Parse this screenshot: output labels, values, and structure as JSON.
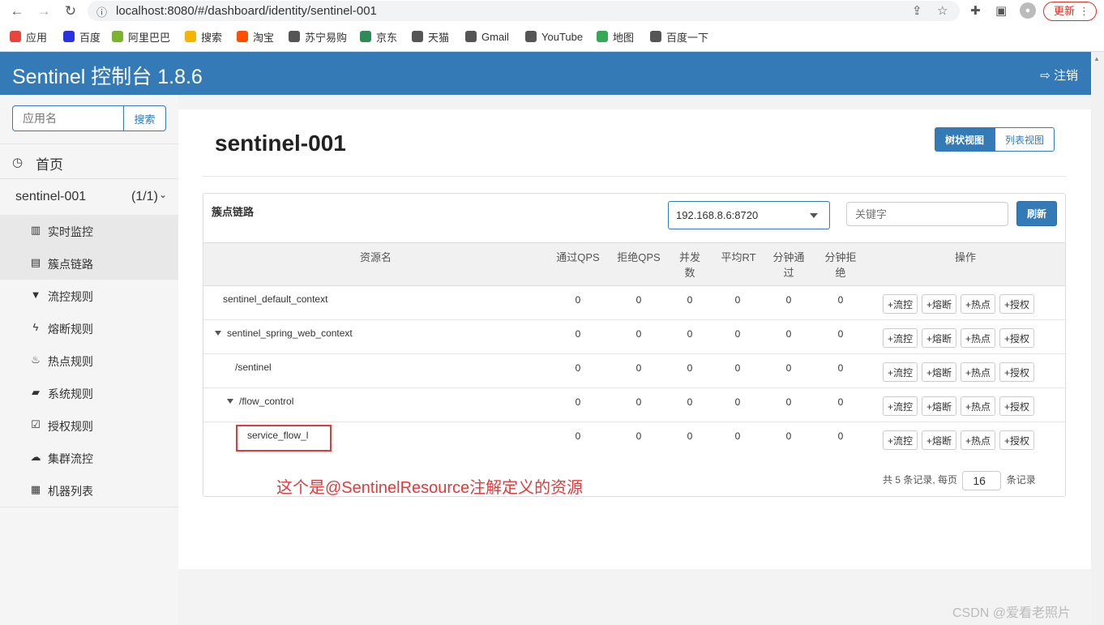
{
  "browser": {
    "url": "localhost:8080/#/dashboard/identity/sentinel-001",
    "update_label": "更新",
    "bookmarks": [
      {
        "label": "应用",
        "icon": "apps-icon",
        "color": "#e8453c"
      },
      {
        "label": "百度",
        "icon": "baidu-icon",
        "color": "#2932e1"
      },
      {
        "label": "阿里巴巴",
        "icon": "alibaba-icon",
        "color": "#7bb32e"
      },
      {
        "label": "搜索",
        "icon": "search-engine-icon",
        "color": "#f4b400"
      },
      {
        "label": "淘宝",
        "icon": "taobao-icon",
        "color": "#ff5000"
      },
      {
        "label": "苏宁易购",
        "icon": "globe-icon",
        "color": "#555555"
      },
      {
        "label": "京东",
        "icon": "jd-icon",
        "color": "#2e8b57"
      },
      {
        "label": "天猫",
        "icon": "globe-icon",
        "color": "#555555"
      },
      {
        "label": "Gmail",
        "icon": "globe-icon",
        "color": "#555555"
      },
      {
        "label": "YouTube",
        "icon": "globe-icon",
        "color": "#555555"
      },
      {
        "label": "地图",
        "icon": "maps-icon",
        "color": "#34a853"
      },
      {
        "label": "百度一下",
        "icon": "globe-icon",
        "color": "#555555"
      }
    ]
  },
  "header": {
    "brand": "Sentinel 控制台 1.8.6",
    "logout": "注销",
    "color": "#337ab7"
  },
  "sidebar": {
    "search_placeholder": "应用名",
    "search_button": "搜索",
    "home": "首页",
    "app_name": "sentinel-001",
    "app_count": "(1/1)",
    "menu": [
      {
        "label": "实时监控",
        "icon": "bar-chart-icon",
        "glyph": "▥",
        "active": true
      },
      {
        "label": "簇点链路",
        "icon": "list-icon",
        "glyph": "▤",
        "active": true
      },
      {
        "label": "流控规则",
        "icon": "filter-icon",
        "glyph": "▼",
        "active": false
      },
      {
        "label": "熔断规则",
        "icon": "flash-icon",
        "glyph": "ϟ",
        "active": false
      },
      {
        "label": "热点规则",
        "icon": "fire-icon",
        "glyph": "♨",
        "active": false
      },
      {
        "label": "系统规则",
        "icon": "lock-icon",
        "glyph": "▰",
        "active": false
      },
      {
        "label": "授权规则",
        "icon": "check-square-icon",
        "glyph": "☑",
        "active": false
      },
      {
        "label": "集群流控",
        "icon": "cloud-icon",
        "glyph": "☁",
        "active": false
      },
      {
        "label": "机器列表",
        "icon": "th-list-icon",
        "glyph": "▦",
        "active": false
      }
    ]
  },
  "main": {
    "title": "sentinel-001",
    "view_tree": "树状视图",
    "view_list": "列表视图",
    "panel_label": "簇点链路",
    "machine": "192.168.8.6:8720",
    "keyword_placeholder": "关键字",
    "refresh": "刷新",
    "columns": [
      "资源名",
      "通过QPS",
      "拒绝QPS",
      "并发数",
      "平均RT",
      "分钟通过",
      "分钟拒绝",
      "操作"
    ],
    "col_lines": {
      "concurrency": [
        "并发",
        "数"
      ],
      "min_pass": [
        "分钟通",
        "过"
      ],
      "min_block": [
        "分钟拒",
        "绝"
      ]
    },
    "actions": [
      "+流控",
      "+熔断",
      "+热点",
      "+授权"
    ],
    "rows": [
      {
        "name": "sentinel_default_context",
        "indent": 0,
        "expand": false,
        "values": [
          "0",
          "0",
          "0",
          "0",
          "0",
          "0"
        ]
      },
      {
        "name": "sentinel_spring_web_context",
        "indent": 0,
        "expand": true,
        "values": [
          "0",
          "0",
          "0",
          "0",
          "0",
          "0"
        ]
      },
      {
        "name": "/sentinel",
        "indent": 1,
        "expand": false,
        "values": [
          "0",
          "0",
          "0",
          "0",
          "0",
          "0"
        ]
      },
      {
        "name": "/flow_control",
        "indent": 1,
        "expand": true,
        "values": [
          "0",
          "0",
          "0",
          "0",
          "0",
          "0"
        ]
      },
      {
        "name": "service_flow_l",
        "indent": 2,
        "expand": false,
        "values": [
          "0",
          "0",
          "0",
          "0",
          "0",
          "0"
        ]
      }
    ],
    "pager_prefix": "共 5 条记录, 每页",
    "page_size": "16",
    "pager_suffix": "条记录"
  },
  "annotation": "这个是@SentinelResource注解定义的资源",
  "watermark": "CSDN @爱看老照片"
}
